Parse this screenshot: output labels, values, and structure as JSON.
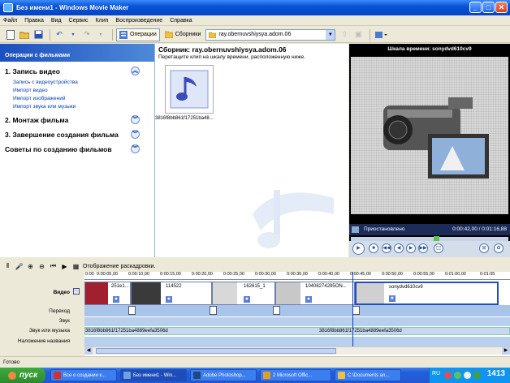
{
  "window": {
    "title": "Без имени1 - Windows Movie Maker",
    "controls": {
      "minimize": "_",
      "maximize": "□",
      "close": "✕"
    }
  },
  "menu": [
    "Файл",
    "Правка",
    "Вид",
    "Сервис",
    "Клип",
    "Воспроизведение",
    "Справка"
  ],
  "toolbar": {
    "operations_label": "Операции",
    "collections_label": "Сборники",
    "collection_select": "ray.obernuvshiysya.adom.06"
  },
  "taskpane": {
    "header": "Операции с фильмами",
    "sections": [
      {
        "title": "1. Запись видео",
        "links": [
          "Запись с видеоустройства",
          "Импорт видео",
          "Импорт изображений",
          "Импорт звука или музыки"
        ]
      },
      {
        "title": "2. Монтаж фильма"
      },
      {
        "title": "3. Завершение создания фильма"
      },
      {
        "title": "Советы по созданию фильмов"
      }
    ]
  },
  "collection": {
    "title": "Сборник: ray.obernuvshiysya.adom.06",
    "subtitle": "Перетащите клип на шкалу времени, расположенную ниже.",
    "clip_label": "3816f8bb861f17251ba48..."
  },
  "monitor": {
    "title": "Шкала времени: sonydvd610cv9",
    "status": "Приостановлено",
    "time": "0:00:42,00 / 0:01:16,88"
  },
  "storyboard": {
    "toggle_label": "Отображение раскадровки.",
    "ruler_ticks": [
      "0:00",
      "0:00:05,00",
      "0:00:10,00",
      "0:00:15,00",
      "0:00:20,00",
      "0:00:25,00",
      "0:00:30,00",
      "0:00:35,00",
      "0:00:40,00",
      "0:00:45,00",
      "0:00:50,00",
      "0:00:55,00",
      "0:01:00,00",
      "0:01:05"
    ],
    "track_labels": {
      "video": "Видео",
      "transition": "Переход",
      "audio": "Звук",
      "music": "Звук или музыка",
      "title": "Наложение названия"
    },
    "video_clips": [
      "251e1...",
      "114522",
      "162615_1",
      "10408274295ON...",
      "sonydvd610cv9"
    ],
    "audio_clips": [
      "3816f8bb861f17251ba4889eefa3506d",
      "3816f8bb861f17251ba4889eefa3506d"
    ]
  },
  "statusbar": "Готово",
  "taskbar": {
    "start": "пуск",
    "items": [
      "Все о создании к...",
      "Без имени1 - Win...",
      "Adobe Photoshop...",
      "2 Microsoft Offic...",
      "C:\\Documents an..."
    ],
    "lang": "RU",
    "clock": "1413"
  },
  "colors": {
    "accent": "#0a53d6",
    "taskpane_header": "#1c4fc0",
    "monitor_bg": "#000000",
    "taskbar": "#245edb",
    "start": "#2d8a2d"
  }
}
